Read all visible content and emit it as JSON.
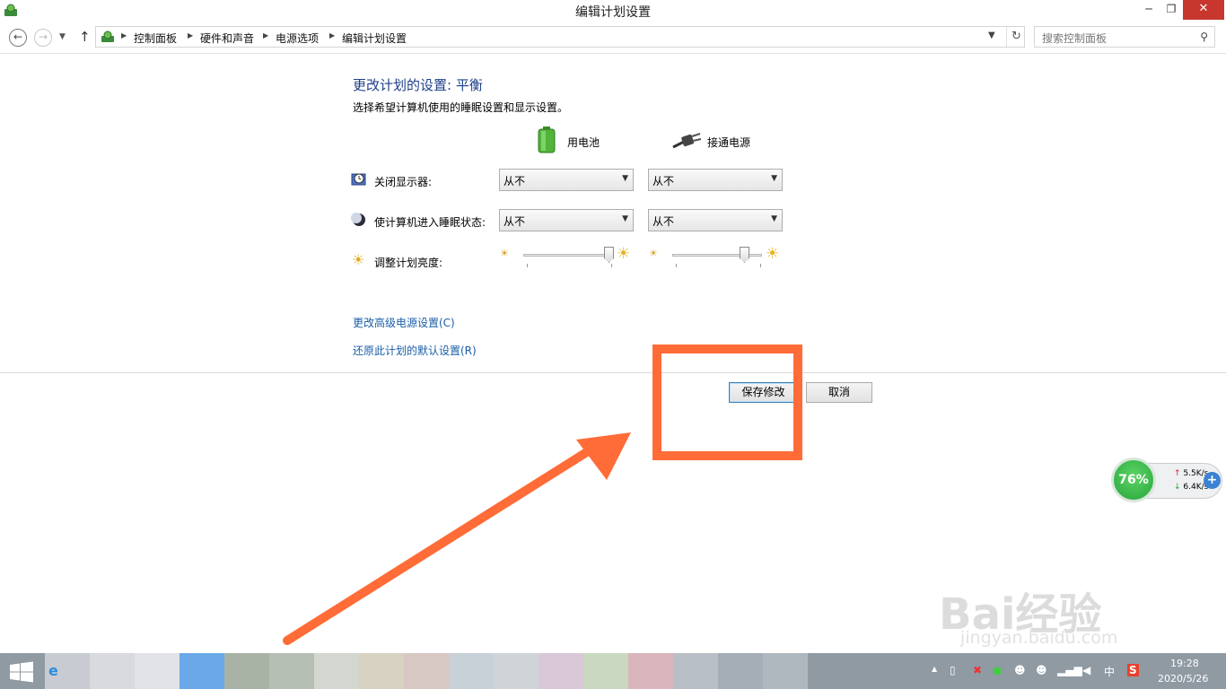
{
  "window": {
    "title": "编辑计划设置",
    "min": "─",
    "max": "❐",
    "close": "✕"
  },
  "nav": {
    "breadcrumbs": [
      "控制面板",
      "硬件和声音",
      "电源选项",
      "编辑计划设置"
    ],
    "search_placeholder": "搜索控制面板"
  },
  "main": {
    "heading": "更改计划的设置: 平衡",
    "subtitle": "选择希望计算机使用的睡眠设置和显示设置。",
    "columns": {
      "battery": "用电池",
      "plugged": "接通电源"
    },
    "rows": {
      "display": {
        "label": "关闭显示器:",
        "battery": "从不",
        "plugged": "从不"
      },
      "sleep": {
        "label": "使计算机进入睡眠状态:",
        "battery": "从不",
        "plugged": "从不"
      },
      "brightness": {
        "label": "调整计划亮度:",
        "battery_level": 0.95,
        "plugged_level": 0.8
      }
    },
    "links": {
      "advanced": "更改高级电源设置(C)",
      "restore": "还原此计划的默认设置(R)"
    },
    "buttons": {
      "save": "保存修改",
      "cancel": "取消"
    }
  },
  "netwidget": {
    "percent": "76%",
    "up": "5.5K/s",
    "down": "6.4K/s"
  },
  "watermark": {
    "brand": "Bai经验",
    "site": "jingyan.baidu.com"
  },
  "taskbar": {
    "time": "19:28",
    "date": "2020/5/26",
    "ime": "中"
  },
  "colors": {
    "accent": "#1e3f8a",
    "link": "#1a5ea8",
    "annotation": "#ff6c37",
    "close": "#c7372d"
  }
}
